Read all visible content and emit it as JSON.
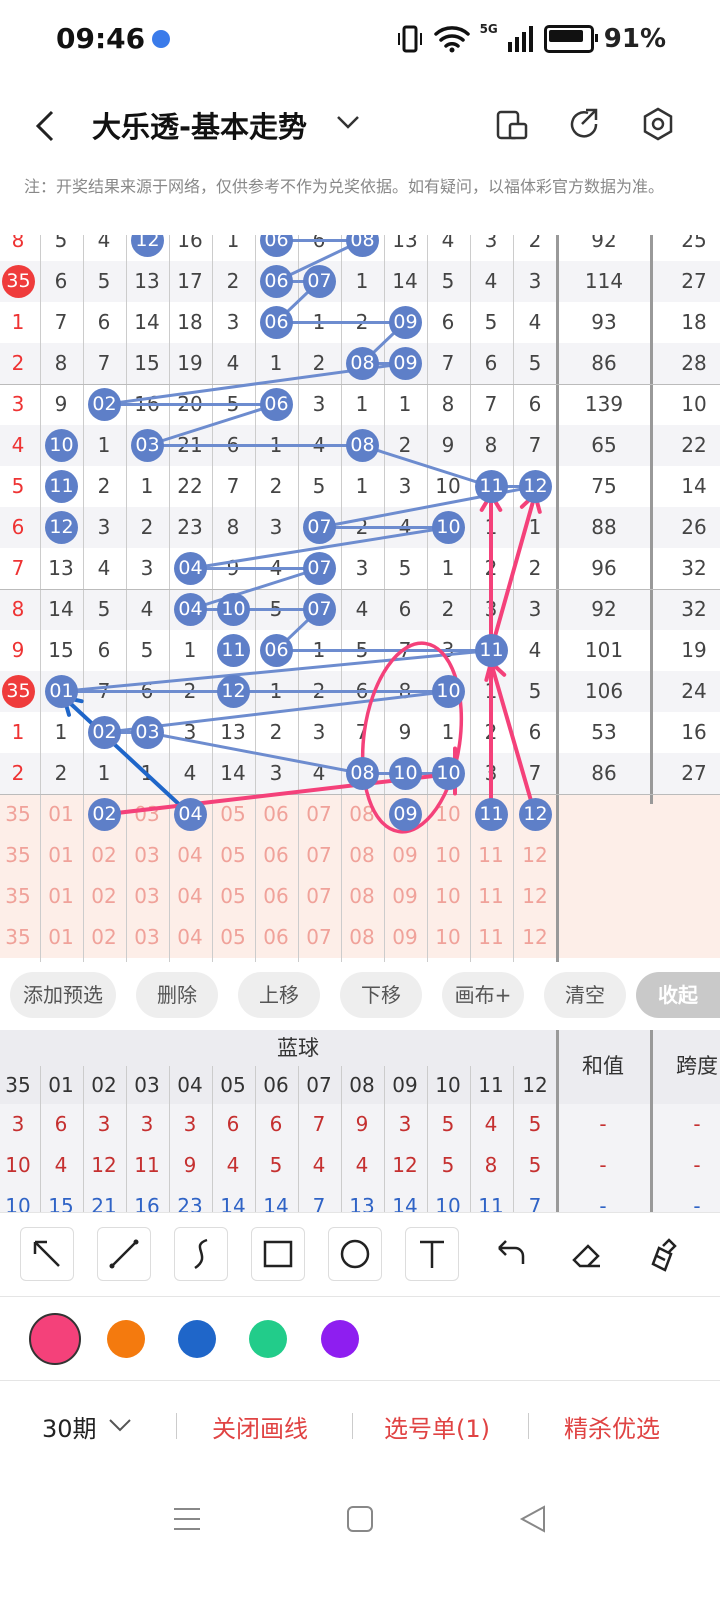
{
  "status": {
    "time": "09:46",
    "network": "5G",
    "battery": "91%"
  },
  "header": {
    "title": "大乐透-基本走势",
    "icons": [
      "back-icon",
      "chevron-down-icon",
      "device-icon",
      "share-icon",
      "settings-icon"
    ]
  },
  "notice": "注：开奖结果来源于网络，仅供参考不作为兑奖依据。如有疑问，以福体彩官方数据为准。",
  "rows": [
    {
      "left": "8",
      "vals": [
        "5",
        "4",
        "12",
        "16",
        "1",
        "06",
        "6",
        "08",
        "13",
        "4",
        "3",
        "2"
      ],
      "sum": "92",
      "span": "25"
    },
    {
      "left": "35",
      "vals": [
        "6",
        "5",
        "13",
        "17",
        "2",
        "06",
        "07",
        "1",
        "14",
        "5",
        "4",
        "3"
      ],
      "sum": "114",
      "span": "27"
    },
    {
      "left": "1",
      "vals": [
        "7",
        "6",
        "14",
        "18",
        "3",
        "06",
        "1",
        "2",
        "09",
        "6",
        "5",
        "4"
      ],
      "sum": "93",
      "span": "18"
    },
    {
      "left": "2",
      "vals": [
        "8",
        "7",
        "15",
        "19",
        "4",
        "1",
        "2",
        "08",
        "09",
        "7",
        "6",
        "5"
      ],
      "sum": "86",
      "span": "28"
    },
    {
      "left": "3",
      "vals": [
        "9",
        "02",
        "16",
        "20",
        "5",
        "06",
        "3",
        "1",
        "1",
        "8",
        "7",
        "6"
      ],
      "sum": "139",
      "span": "10"
    },
    {
      "left": "4",
      "vals": [
        "10",
        "1",
        "03",
        "21",
        "6",
        "1",
        "4",
        "08",
        "2",
        "9",
        "8",
        "7"
      ],
      "sum": "65",
      "span": "22"
    },
    {
      "left": "5",
      "vals": [
        "11",
        "2",
        "1",
        "22",
        "7",
        "2",
        "5",
        "1",
        "3",
        "10",
        "11",
        "12"
      ],
      "sum": "75",
      "span": "14"
    },
    {
      "left": "6",
      "vals": [
        "12",
        "3",
        "2",
        "23",
        "8",
        "3",
        "07",
        "2",
        "4",
        "10",
        "1",
        "1"
      ],
      "sum": "88",
      "span": "26"
    },
    {
      "left": "7",
      "vals": [
        "13",
        "4",
        "3",
        "04",
        "9",
        "4",
        "07",
        "3",
        "5",
        "1",
        "2",
        "2"
      ],
      "sum": "96",
      "span": "32"
    },
    {
      "left": "8",
      "vals": [
        "14",
        "5",
        "4",
        "04",
        "10",
        "5",
        "07",
        "4",
        "6",
        "2",
        "3",
        "3"
      ],
      "sum": "92",
      "span": "32"
    },
    {
      "left": "9",
      "vals": [
        "15",
        "6",
        "5",
        "1",
        "11",
        "06",
        "1",
        "5",
        "7",
        "3",
        "11",
        "4"
      ],
      "sum": "101",
      "span": "19"
    },
    {
      "left": "35",
      "vals": [
        "01",
        "7",
        "6",
        "2",
        "12",
        "1",
        "2",
        "6",
        "8",
        "10",
        "1",
        "5"
      ],
      "sum": "106",
      "span": "24"
    },
    {
      "left": "1",
      "vals": [
        "1",
        "02",
        "03",
        "3",
        "13",
        "2",
        "3",
        "7",
        "9",
        "1",
        "2",
        "6"
      ],
      "sum": "53",
      "span": "16"
    },
    {
      "left": "2",
      "vals": [
        "2",
        "1",
        "1",
        "4",
        "14",
        "3",
        "4",
        "08",
        "10",
        "10",
        "3",
        "7"
      ],
      "sum": "86",
      "span": "27"
    }
  ],
  "ball_rows": [
    {
      "left": "35",
      "vals": [
        "01",
        "02",
        "03",
        "04",
        "05",
        "06",
        "07",
        "08",
        "09",
        "10",
        "11",
        "12"
      ]
    },
    {
      "left": "35",
      "vals": [
        "01",
        "02",
        "03",
        "04",
        "05",
        "06",
        "07",
        "08",
        "09",
        "10",
        "11",
        "12"
      ]
    },
    {
      "left": "35",
      "vals": [
        "01",
        "02",
        "03",
        "04",
        "05",
        "06",
        "07",
        "08",
        "09",
        "10",
        "11",
        "12"
      ]
    },
    {
      "left": "35",
      "vals": [
        "01",
        "02",
        "03",
        "04",
        "05",
        "06",
        "07",
        "08",
        "09",
        "10",
        "11",
        "12"
      ]
    }
  ],
  "actions": [
    "添加预选",
    "删除",
    "上移",
    "下移",
    "画布+",
    "清空",
    "收起"
  ],
  "table2": {
    "group": "蓝球",
    "sum_label": "和值",
    "span_label": "跨度",
    "head": [
      "35",
      "01",
      "02",
      "03",
      "04",
      "05",
      "06",
      "07",
      "08",
      "09",
      "10",
      "11",
      "12"
    ],
    "rows": [
      {
        "left": "3",
        "vals": [
          "6",
          "3",
          "3",
          "3",
          "6",
          "6",
          "7",
          "9",
          "3",
          "5",
          "4",
          "5"
        ],
        "sum": "-",
        "span": "-"
      },
      {
        "left": "10",
        "vals": [
          "4",
          "12",
          "11",
          "9",
          "4",
          "5",
          "4",
          "4",
          "12",
          "5",
          "8",
          "5"
        ],
        "sum": "-",
        "span": "-"
      },
      {
        "left": "10",
        "vals": [
          "15",
          "21",
          "16",
          "23",
          "14",
          "14",
          "7",
          "13",
          "14",
          "10",
          "11",
          "7"
        ],
        "sum": "-",
        "span": "-"
      }
    ]
  },
  "tools": [
    "arrow-tool-icon",
    "line-tool-icon",
    "curve-tool-icon",
    "rect-tool-icon",
    "circle-tool-icon",
    "text-tool-icon",
    "undo-icon",
    "eraser-icon",
    "clear-brush-icon"
  ],
  "colors": [
    "#f4417a",
    "#f47a0e",
    "#1f66c9",
    "#22cc8a",
    "#8e1ef0"
  ],
  "bottom": {
    "period": "30期",
    "close_draw": "关闭画线",
    "pick_list": "选号单(1)",
    "best": "精杀优选"
  }
}
